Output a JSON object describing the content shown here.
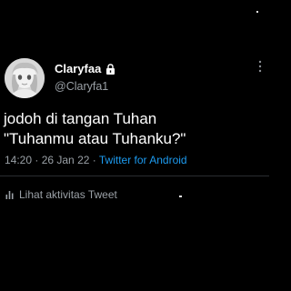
{
  "tweet": {
    "display_name": "Claryfaa",
    "handle": "@Claryfa1",
    "lines": [
      "jodoh di tangan Tuhan",
      "\"Tuhanmu atau Tuhanku?\""
    ],
    "time": "14:20",
    "separator": " · ",
    "date": "26 Jan 22",
    "source": "Twitter for Android",
    "activity_label": "Lihat aktivitas Tweet"
  },
  "icons": {
    "avatar": "profile-avatar",
    "verified": "lock-icon",
    "more": "more-icon",
    "activity": "bar-chart-icon"
  },
  "colors": {
    "background": "#000000",
    "text": "#ffffff",
    "secondary_text": "#9aa0a6",
    "link": "#1d9bf0"
  }
}
